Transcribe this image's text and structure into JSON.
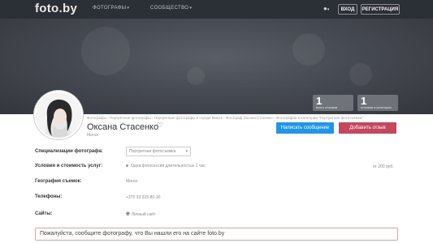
{
  "header": {
    "logo": "foto.by",
    "nav": [
      {
        "label": "ФОТОГРАФЫ"
      },
      {
        "label": "СООБЩЕСТВО"
      }
    ],
    "login": "ВХОД",
    "register": "РЕГИСТРАЦИЯ"
  },
  "stats": [
    {
      "num": "1",
      "label": "всего отзывов"
    },
    {
      "num": "1",
      "label": "отзывов в категории"
    }
  ],
  "profile": {
    "breadcrumb": "Фотографы › Портретные фотографы › Портретные фотографы в городе Минск › Фотограф Оксана Стасенко › Фотографии в категории \"Портретная фотосъемка\"",
    "name": "Оксана Стасенко",
    "city": "Минск",
    "message_btn": "Написать сообщение",
    "review_btn": "Добавить отзыв"
  },
  "details": {
    "spec_label": "Специализации фотографа:",
    "spec_value": "Портретная фотосъемка",
    "terms_label": "Условия и стоимость услуг:",
    "terms_value": "Одна фотосессия длительностью 1 час",
    "terms_price": "от 200 руб.",
    "geo_label": "География съемок:",
    "geo_value": "Минск",
    "phone_label": "Телефоны:",
    "phone_value": "+375 33 333-80-30",
    "sites_label": "Сайты:",
    "sites_value": "Личный сайт"
  },
  "notice": "Пожалуйста, сообщите фотографу, что Вы нашли его на сайте foto.by"
}
